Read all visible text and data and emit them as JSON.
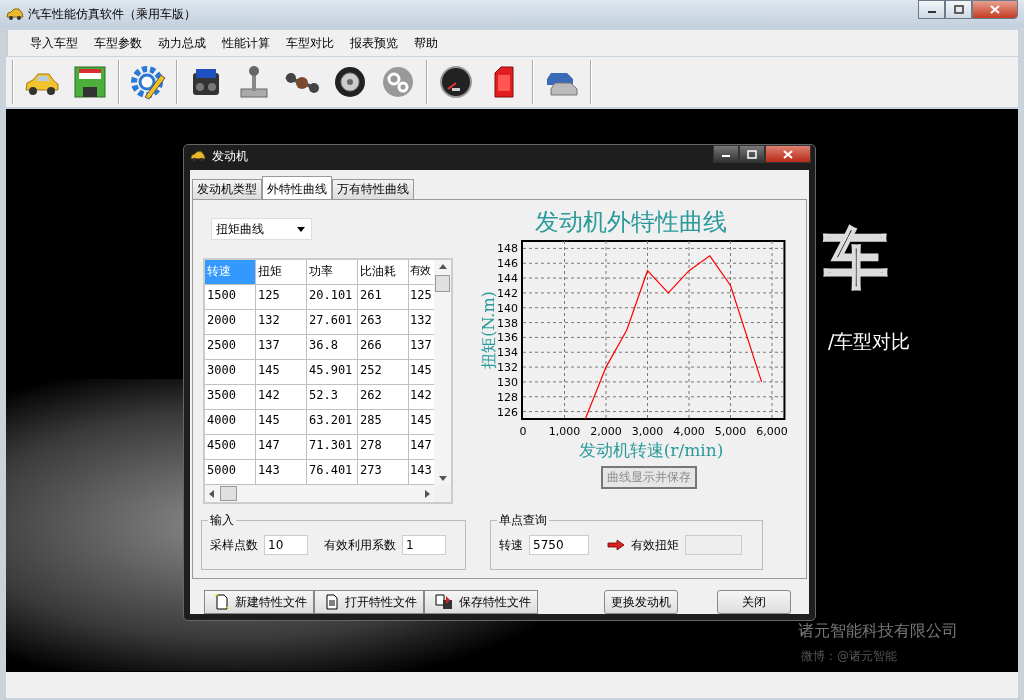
{
  "window": {
    "title": "汽车性能仿真软件（乘用车版）"
  },
  "menu": [
    "导入车型",
    "车型参数",
    "动力总成",
    "性能计算",
    "车型对比",
    "报表预览",
    "帮助"
  ],
  "background": {
    "logo_text": "车",
    "subtitle": "/车型对比",
    "company": "诸元智能科技有限公司",
    "weibo": "微博：@诸元智能"
  },
  "dialog": {
    "title": "发动机",
    "tabs": [
      {
        "label": "发动机类型",
        "selected": false
      },
      {
        "label": "外特性曲线",
        "selected": true
      },
      {
        "label": "万有特性曲线",
        "selected": false
      }
    ],
    "curve_select": "扭矩曲线",
    "table": {
      "columns": [
        {
          "label": "转速",
          "selected": true
        },
        {
          "label": "扭矩",
          "selected": false
        },
        {
          "label": "功率",
          "selected": false
        },
        {
          "label": "比油耗",
          "selected": false
        },
        {
          "label": "有效",
          "selected": false
        }
      ],
      "rows": [
        [
          "1500",
          "125",
          "20.101",
          "261",
          "125"
        ],
        [
          "2000",
          "132",
          "27.601",
          "263",
          "132"
        ],
        [
          "2500",
          "137",
          "36.8",
          "266",
          "137"
        ],
        [
          "3000",
          "145",
          "45.901",
          "252",
          "145"
        ],
        [
          "3500",
          "142",
          "52.3",
          "262",
          "142"
        ],
        [
          "4000",
          "145",
          "63.201",
          "285",
          "145"
        ],
        [
          "4500",
          "147",
          "71.301",
          "278",
          "147"
        ],
        [
          "5000",
          "143",
          "76.401",
          "273",
          "143"
        ]
      ]
    },
    "chart_data": {
      "type": "line",
      "title": "发动机外特性曲线",
      "xlabel": "发动机转速(r/min)",
      "ylabel": "扭矩(N.m)",
      "x": [
        1500,
        2000,
        2500,
        3000,
        3500,
        4000,
        4500,
        5000,
        5750
      ],
      "grid": true,
      "series": [
        {
          "color": "#ff0000",
          "values": [
            125,
            132,
            137,
            145,
            142,
            145,
            147,
            143,
            130
          ]
        }
      ],
      "xlim": [
        0,
        6300
      ],
      "ylim": [
        125,
        149
      ],
      "xticks": [
        {
          "value": 0,
          "label": "0"
        },
        {
          "value": 1000,
          "label": "1,000"
        },
        {
          "value": 2000,
          "label": "2,000"
        },
        {
          "value": 3000,
          "label": "3,000"
        },
        {
          "value": 4000,
          "label": "4,000"
        },
        {
          "value": 5000,
          "label": "5,000"
        },
        {
          "value": 6000,
          "label": "6,000"
        }
      ],
      "yticks": [
        126,
        128,
        130,
        132,
        134,
        136,
        138,
        140,
        142,
        144,
        146,
        148
      ]
    },
    "plot_button": {
      "label": "曲线显示并保存",
      "disabled": true
    },
    "input_group": {
      "title": "输入",
      "fields": [
        {
          "label": "采样点数",
          "value": "10"
        },
        {
          "label": "有效利用系数",
          "value": "1"
        }
      ]
    },
    "query_group": {
      "title": "单点查询",
      "speed_label": "转速",
      "speed_value": "5750",
      "result_label": "有效扭矩"
    },
    "file_buttons": [
      {
        "kind": "new",
        "label": "新建特性文件"
      },
      {
        "kind": "open",
        "label": "打开特性文件"
      },
      {
        "kind": "save",
        "label": "保存特性文件"
      }
    ],
    "buttons": [
      "更换发动机",
      "关闭"
    ]
  }
}
